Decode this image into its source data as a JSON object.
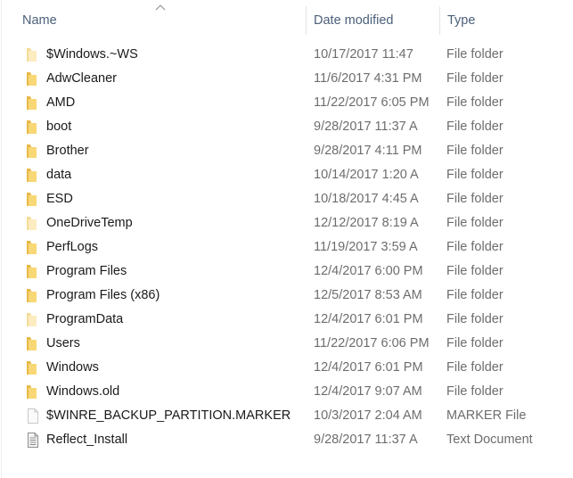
{
  "columns": {
    "name": "Name",
    "date": "Date modified",
    "type": "Type",
    "sort_indicator": "sort-ascending-icon"
  },
  "colors": {
    "folder": "#f8d775",
    "folder_dark": "#e8b94a",
    "folder_hidden": "#fcecc0",
    "header_text": "#4c607a",
    "name_text": "#1a1a1a",
    "meta_text": "#6d6d6d"
  },
  "files": [
    {
      "name": "$Windows.~WS",
      "date": "10/17/2017 11:47",
      "type": "File folder",
      "icon": "folder-icon",
      "hidden": true
    },
    {
      "name": "AdwCleaner",
      "date": "11/6/2017 4:31 PM",
      "type": "File folder",
      "icon": "folder-icon",
      "hidden": false
    },
    {
      "name": "AMD",
      "date": "11/22/2017 6:05 PM",
      "type": "File folder",
      "icon": "folder-icon",
      "hidden": false
    },
    {
      "name": "boot",
      "date": "9/28/2017 11:37 A",
      "type": "File folder",
      "icon": "folder-icon",
      "hidden": false
    },
    {
      "name": "Brother",
      "date": "9/28/2017 4:11 PM",
      "type": "File folder",
      "icon": "folder-icon",
      "hidden": false
    },
    {
      "name": "data",
      "date": "10/14/2017 1:20 A",
      "type": "File folder",
      "icon": "folder-icon",
      "hidden": false
    },
    {
      "name": "ESD",
      "date": "10/18/2017 4:45 A",
      "type": "File folder",
      "icon": "folder-icon",
      "hidden": false
    },
    {
      "name": "OneDriveTemp",
      "date": "12/12/2017 8:19 A",
      "type": "File folder",
      "icon": "folder-icon",
      "hidden": true
    },
    {
      "name": "PerfLogs",
      "date": "11/19/2017 3:59 A",
      "type": "File folder",
      "icon": "folder-icon",
      "hidden": false
    },
    {
      "name": "Program Files",
      "date": "12/4/2017 6:00 PM",
      "type": "File folder",
      "icon": "folder-icon",
      "hidden": false
    },
    {
      "name": "Program Files (x86)",
      "date": "12/5/2017 8:53 AM",
      "type": "File folder",
      "icon": "folder-icon",
      "hidden": false
    },
    {
      "name": "ProgramData",
      "date": "12/4/2017 6:01 PM",
      "type": "File folder",
      "icon": "folder-icon",
      "hidden": true
    },
    {
      "name": "Users",
      "date": "11/22/2017 6:06 PM",
      "type": "File folder",
      "icon": "folder-icon",
      "hidden": false
    },
    {
      "name": "Windows",
      "date": "12/4/2017 6:01 PM",
      "type": "File folder",
      "icon": "folder-icon",
      "hidden": false
    },
    {
      "name": "Windows.old",
      "date": "12/4/2017 9:07 AM",
      "type": "File folder",
      "icon": "folder-icon",
      "hidden": false
    },
    {
      "name": "$WINRE_BACKUP_PARTITION.MARKER",
      "date": "10/3/2017 2:04 AM",
      "type": "MARKER File",
      "icon": "blank-file-icon",
      "hidden": true
    },
    {
      "name": "Reflect_Install",
      "date": "9/28/2017 11:37 A",
      "type": "Text Document",
      "icon": "text-document-icon",
      "hidden": false
    }
  ]
}
